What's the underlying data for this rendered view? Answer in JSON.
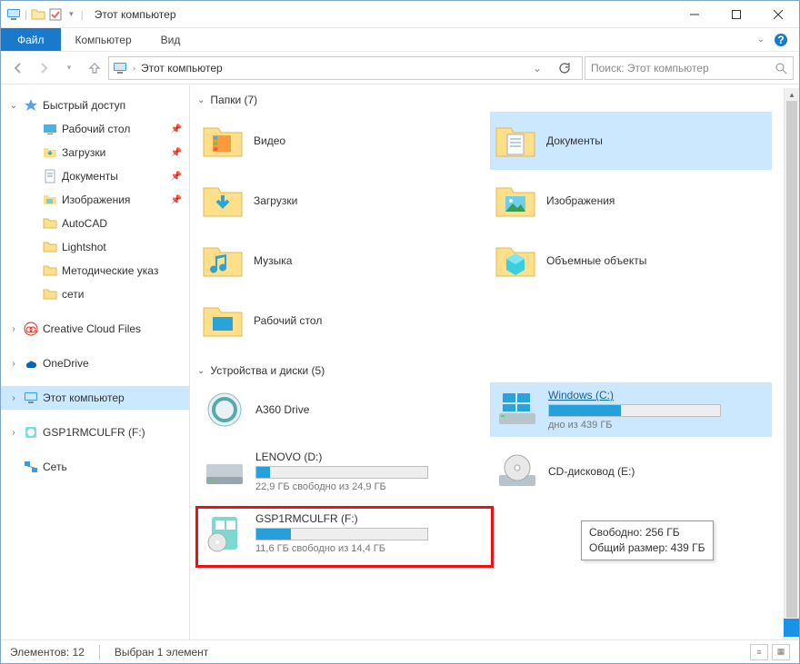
{
  "window": {
    "title": "Этот компьютер"
  },
  "ribbon": {
    "file": "Файл",
    "tabs": [
      "Компьютер",
      "Вид"
    ]
  },
  "address": {
    "path": "Этот компьютер"
  },
  "search": {
    "placeholder": "Поиск: Этот компьютер"
  },
  "nav": {
    "quick_access": "Быстрый доступ",
    "items": [
      {
        "label": "Рабочий стол",
        "pinned": true
      },
      {
        "label": "Загрузки",
        "pinned": true
      },
      {
        "label": "Документы",
        "pinned": true
      },
      {
        "label": "Изображения",
        "pinned": true
      },
      {
        "label": "AutoCAD",
        "pinned": false
      },
      {
        "label": "Lightshot",
        "pinned": false
      },
      {
        "label": "Методические указ",
        "pinned": false
      },
      {
        "label": "сети",
        "pinned": false
      }
    ],
    "creative_cloud": "Creative Cloud Files",
    "onedrive": "OneDrive",
    "this_pc": "Этот компьютер",
    "drive_f": "GSP1RMCULFR (F:)",
    "network": "Сеть"
  },
  "groups": {
    "folders": {
      "label": "Папки (7)"
    },
    "devices": {
      "label": "Устройства и диски (5)"
    }
  },
  "folders": [
    {
      "label": "Видео"
    },
    {
      "label": "Документы"
    },
    {
      "label": "Загрузки"
    },
    {
      "label": "Изображения"
    },
    {
      "label": "Музыка"
    },
    {
      "label": "Объемные объекты"
    },
    {
      "label": "Рабочий стол"
    }
  ],
  "drives": {
    "a360": {
      "name": "A360 Drive"
    },
    "windows": {
      "name": "Windows (C:)",
      "space": "дно из 439 ГБ",
      "fill": 42
    },
    "lenovo": {
      "name": "LENOVO (D:)",
      "space": "22,9 ГБ свободно из 24,9 ГБ",
      "fill": 8
    },
    "cdrom": {
      "name": "CD-дисковод (E:)"
    },
    "gsp": {
      "name": "GSP1RMCULFR (F:)",
      "space": "11,6 ГБ свободно из 14,4 ГБ",
      "fill": 20
    }
  },
  "tooltip": {
    "line1": "Свободно: 256 ГБ",
    "line2": "Общий размер: 439 ГБ"
  },
  "status": {
    "items": "Элементов: 12",
    "selected": "Выбран 1 элемент"
  }
}
